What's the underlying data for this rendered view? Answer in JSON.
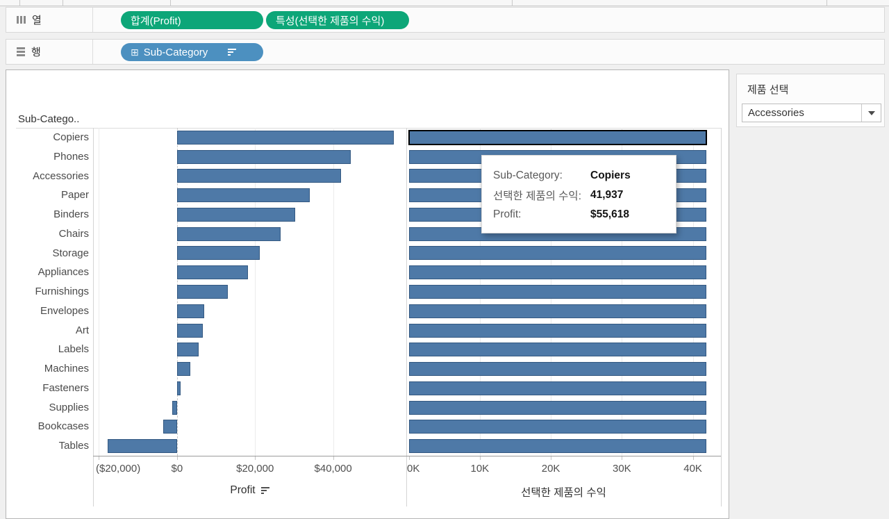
{
  "shelves": {
    "columns": {
      "label": "열",
      "pills": [
        {
          "label": "합계(Profit)",
          "type": "measure-green"
        },
        {
          "label": "특성(선택한 제품의 수익)",
          "type": "measure-green"
        }
      ]
    },
    "rows": {
      "label": "행",
      "pills": [
        {
          "label": "Sub-Category",
          "type": "dimension-blue",
          "sorted": "descending"
        }
      ]
    }
  },
  "parameter": {
    "title": "제품 선택",
    "value": "Accessories"
  },
  "tooltip": {
    "rows": [
      {
        "label": "Sub-Category:",
        "value": "Copiers"
      },
      {
        "label": "선택한 제품의 수익:",
        "value": "41,937"
      },
      {
        "label": "Profit:",
        "value": "$55,618"
      }
    ]
  },
  "chart_data": {
    "type": "bar",
    "orientation": "horizontal",
    "row_field_header": "Sub-Catego..",
    "categories": [
      "Copiers",
      "Phones",
      "Accessories",
      "Paper",
      "Binders",
      "Chairs",
      "Storage",
      "Appliances",
      "Furnishings",
      "Envelopes",
      "Art",
      "Labels",
      "Machines",
      "Fasteners",
      "Supplies",
      "Bookcases",
      "Tables"
    ],
    "bar_color": "#4e79a7",
    "panes": [
      {
        "name": "Profit",
        "axis_title": "Profit",
        "sorted": true,
        "values": [
          55618,
          44516,
          41937,
          34054,
          30222,
          26590,
          21279,
          18138,
          13059,
          6964,
          6528,
          5546,
          3385,
          950,
          -1189,
          -3473,
          -17725
        ],
        "tick_labels": [
          "($20,000)",
          "$0",
          "$20,000",
          "$40,000"
        ],
        "tick_values": [
          -20000,
          0,
          20000,
          40000
        ],
        "xlim": [
          -21500,
          58750
        ],
        "grid": true
      },
      {
        "name": "선택한 제품의 수익",
        "axis_title": "선택한 제품의 수익",
        "sorted": false,
        "values": [
          41937,
          41937,
          41937,
          41937,
          41937,
          41937,
          41937,
          41937,
          41937,
          41937,
          41937,
          41937,
          41937,
          41937,
          41937,
          41937,
          41937
        ],
        "tick_labels": [
          "0K",
          "10K",
          "20K",
          "30K",
          "40K"
        ],
        "tick_values": [
          0,
          10000,
          20000,
          30000,
          40000
        ],
        "xlim": [
          -350,
          43950
        ],
        "grid": true,
        "selected_index": 0,
        "selected_category": "Copiers"
      }
    ]
  }
}
